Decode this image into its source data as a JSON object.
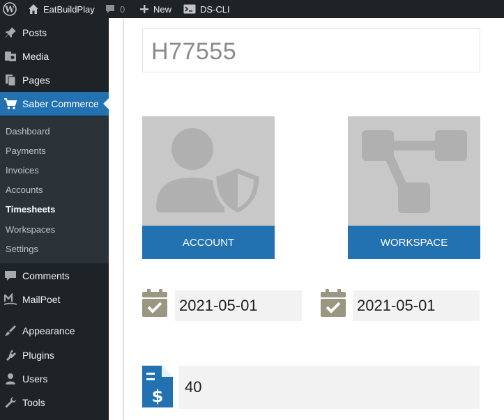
{
  "adminbar": {
    "site_name": "EatBuildPlay",
    "comments_count": "0",
    "new_label": "New",
    "cli_label": "DS-CLI"
  },
  "sidebar": {
    "items": [
      {
        "label": "Posts",
        "icon": "pin-icon"
      },
      {
        "label": "Media",
        "icon": "media-icon"
      },
      {
        "label": "Pages",
        "icon": "pages-icon"
      },
      {
        "label": "Saber Commerce",
        "icon": "cart-icon"
      },
      {
        "label": "Comments",
        "icon": "comment-icon"
      },
      {
        "label": "MailPoet",
        "icon": "mailpoet-icon"
      },
      {
        "label": "Appearance",
        "icon": "brush-icon"
      },
      {
        "label": "Plugins",
        "icon": "plug-icon"
      },
      {
        "label": "Users",
        "icon": "user-icon"
      },
      {
        "label": "Tools",
        "icon": "wrench-icon"
      }
    ],
    "submenu": [
      "Dashboard",
      "Payments",
      "Invoices",
      "Accounts",
      "Timesheets",
      "Workspaces",
      "Settings"
    ],
    "active_submenu": "Timesheets"
  },
  "main": {
    "title": "H77555",
    "account_label": "ACCOUNT",
    "workspace_label": "WORKSPACE",
    "start_date": "2021-05-01",
    "end_date": "2021-05-01",
    "amount": "40"
  },
  "colors": {
    "admin_dark": "#1d2327",
    "accent_blue": "#2271b1",
    "card_gray": "#c8c8c8",
    "calendar_icon": "#9a9681"
  }
}
